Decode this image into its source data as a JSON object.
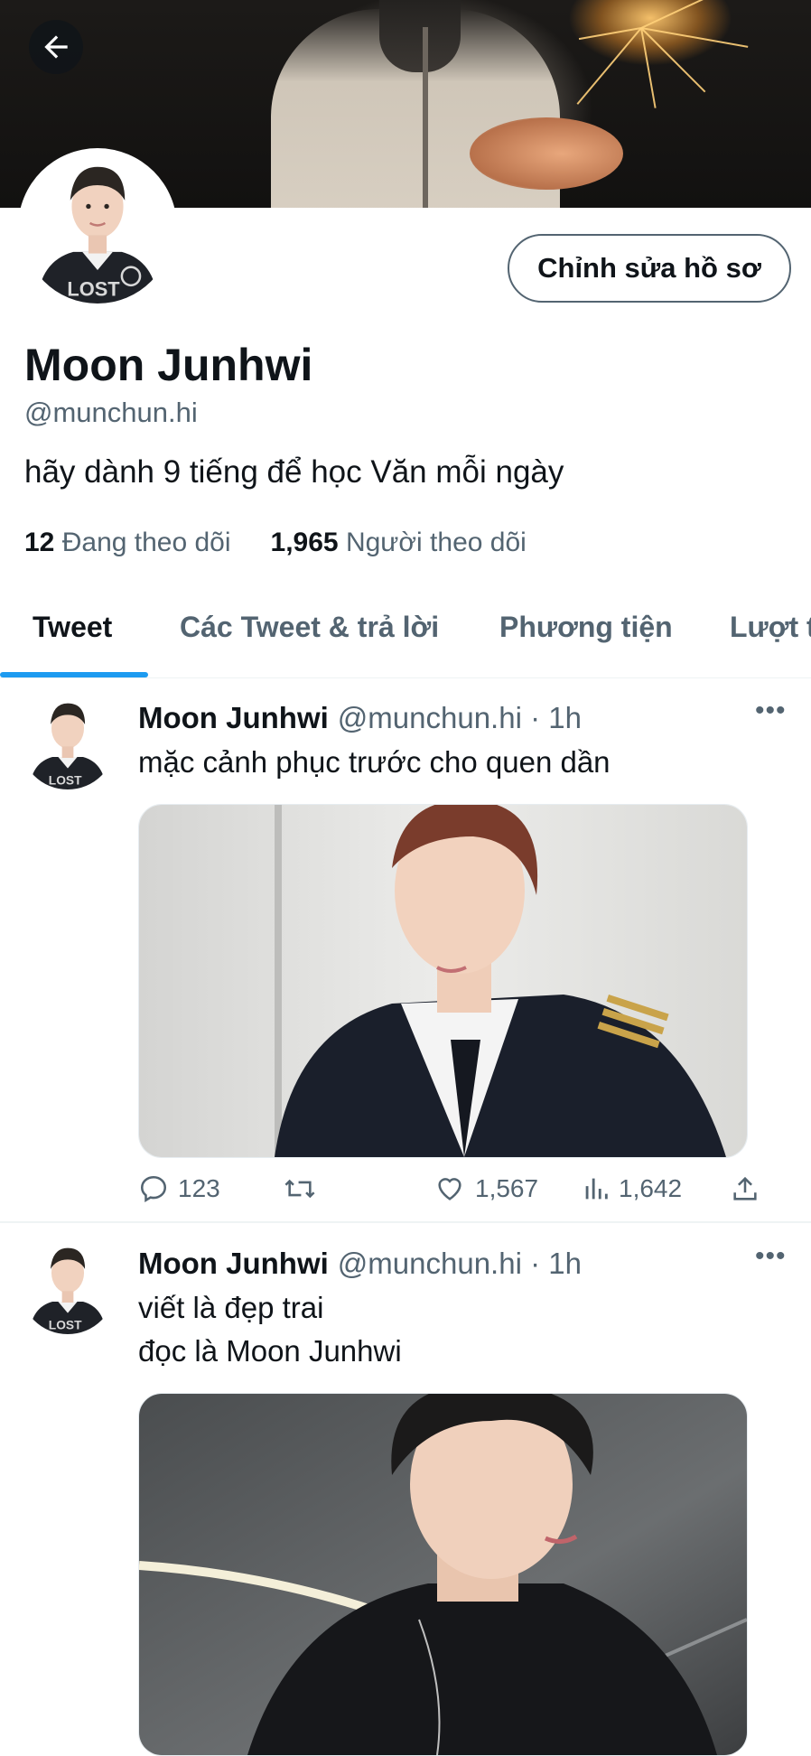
{
  "header": {
    "back_label": "Back"
  },
  "profile": {
    "edit_button": "Chỉnh sửa hồ sơ",
    "name": "Moon Junhwi",
    "handle": "@munchun.hi",
    "bio": "hãy dành 9 tiếng để học Văn mỗi ngày",
    "following_count": "12",
    "following_label": "Đang theo dõi",
    "followers_count": "1,965",
    "followers_label": "Người theo dõi"
  },
  "tabs": [
    {
      "label": "Tweet",
      "active": true
    },
    {
      "label": "Các Tweet & trả lời",
      "active": false
    },
    {
      "label": "Phương tiện",
      "active": false
    },
    {
      "label": "Lượt t",
      "active": false
    }
  ],
  "tweets": [
    {
      "name": "Moon Junhwi",
      "handle_time": "@munchun.hi · 1h",
      "text_lines": [
        "mặc cảnh phục trước cho quen dần"
      ],
      "replies": "123",
      "retweets": "",
      "likes": "1,567",
      "views": "1,642"
    },
    {
      "name": "Moon Junhwi",
      "handle_time": "@munchun.hi · 1h",
      "text_lines": [
        "viết là đẹp trai",
        "đọc là Moon Junhwi"
      ]
    }
  ],
  "icons": {
    "back": "arrow-left-icon",
    "more": "more-horizontal-icon",
    "reply": "reply-icon",
    "retweet": "retweet-icon",
    "like": "heart-icon",
    "views": "bar-chart-icon",
    "share": "share-icon"
  },
  "colors": {
    "accent": "#1d9bf0",
    "text": "#0f1419",
    "secondary": "#536471"
  }
}
